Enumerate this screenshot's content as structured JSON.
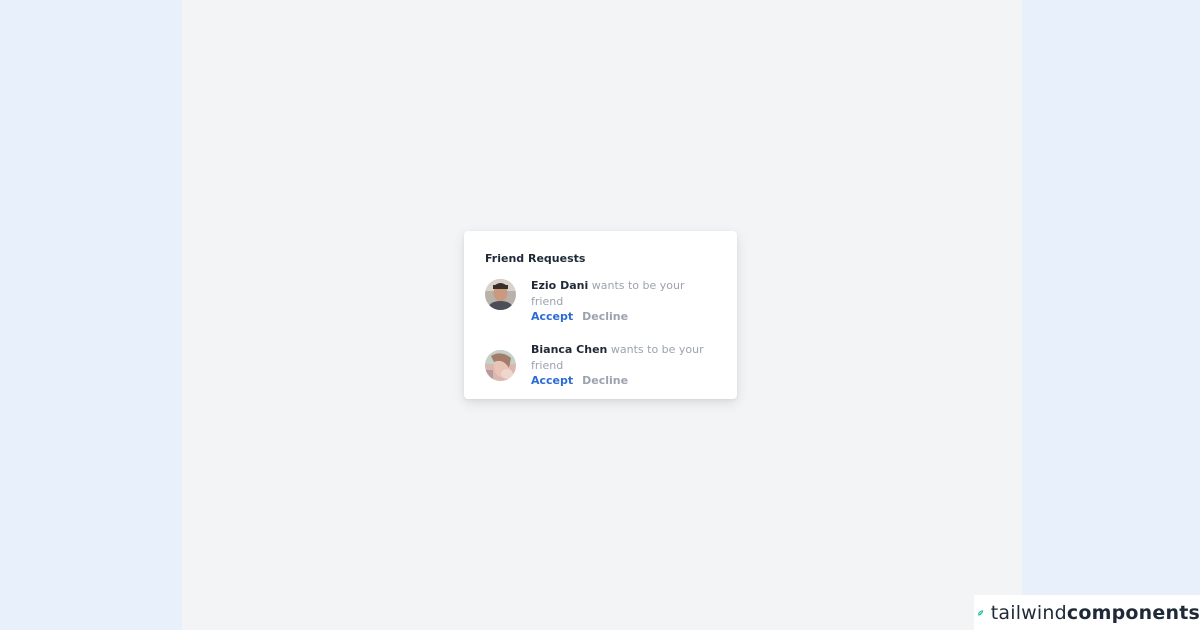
{
  "card": {
    "title": "Friend Requests"
  },
  "requests": [
    {
      "name": "Ezio Dani",
      "message": " wants to be your friend",
      "accept_label": "Accept",
      "decline_label": "Decline"
    },
    {
      "name": "Bianca Chen",
      "message": " wants to be your friend",
      "accept_label": "Accept",
      "decline_label": "Decline"
    }
  ],
  "brand": {
    "light": "tailwind",
    "bold": "components"
  },
  "colors": {
    "accept": "#2b6cd4",
    "decline": "#9ca3af",
    "page_bg": "#f3f4f6",
    "outer_bg": "#e8f1fb",
    "brand_icon": "#14b8a6"
  }
}
